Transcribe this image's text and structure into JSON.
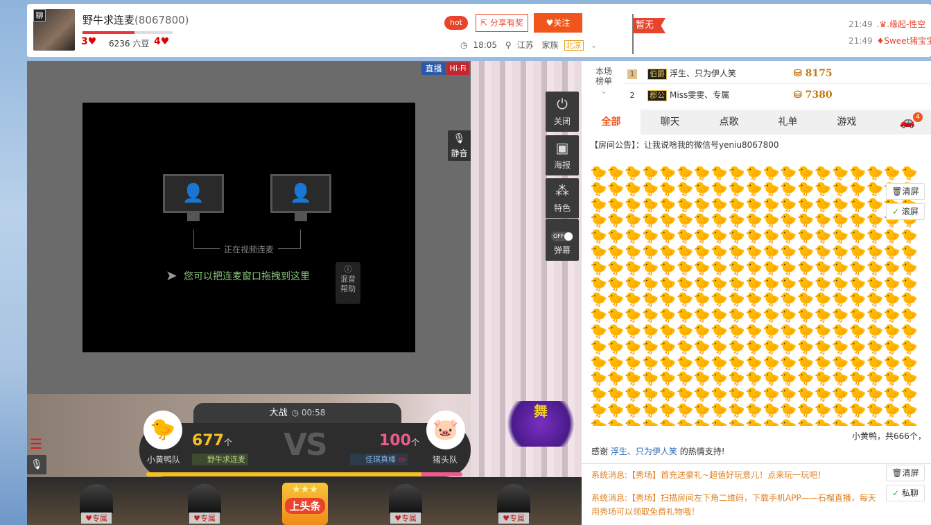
{
  "header": {
    "avatar_badge": "聊",
    "anchor_name": "野牛求连麦",
    "anchor_id": "(8067800)",
    "level_progress": 0.58,
    "level_left": "3",
    "douzi": "6236 六豆",
    "level_right": "4",
    "hot": "hot",
    "share": "分享有奖",
    "follow": "关注",
    "time": "18:05",
    "location": "江苏",
    "family_label": "家族",
    "family_tag": "北凉",
    "flag": "暂无",
    "messages": [
      {
        "time": "21:49",
        "user": ".♛.缘起-性空"
      },
      {
        "time": "21:49",
        "user": "♦Sweet猪宝宝"
      }
    ]
  },
  "video": {
    "badge_live": "直播",
    "badge_hifi": "Hi-Fi",
    "mute": "静音",
    "link_text": "正在视频连麦",
    "drag_text": "您可以把连麦窗口拖拽到这里",
    "mix_help_l1": "混音",
    "mix_help_l2": "帮助"
  },
  "side_tools": {
    "close": "关闭",
    "poster": "海报",
    "feature": "特色",
    "danmu_state": "OFF",
    "danmu": "弹幕"
  },
  "battle": {
    "title": "大战",
    "timer": "00:58",
    "left_team": "小黄鸭队",
    "right_team": "猪头队",
    "left_score": "677",
    "right_score": "100",
    "unit": "个",
    "vs": "VS",
    "left_leader": "野牛求连麦",
    "right_leader": "佳琪真棒",
    "left_share": 0.87,
    "event_logo": "舞"
  },
  "gift_row": {
    "tag": "专属",
    "headline": "上头条"
  },
  "rank": {
    "head_l1": "本场",
    "head_l2": "榜单",
    "rows": [
      {
        "num": "1",
        "tag": "伯爵",
        "name": "浮生、只为伊人笑",
        "coins": "8175"
      },
      {
        "num": "2",
        "tag": "郡公",
        "name": "Miss雯雯、专属",
        "coins": "7380"
      }
    ]
  },
  "tabs": {
    "all": "全部",
    "chat": "聊天",
    "song": "点歌",
    "gift": "礼单",
    "game": "游戏",
    "car_badge": "4"
  },
  "chat": {
    "announce": "【房间公告】：让我说啥我的微信号yeniu8067800",
    "duck_count": "小黄鸭，共666个，",
    "thanks_prefix": "感谢",
    "thanks_user": "浮生、只为伊人笑",
    "thanks_suffix": "的热情支持!",
    "clear": "清屏",
    "scroll": "滚屏",
    "sys1": "系统消息:【秀场】首充送豪礼~超值好玩意儿！点来玩一玩吧！",
    "sys2": "系统消息:【秀场】扫描房间左下角二维码，下载手机APP——石榴直播，每天用秀场可以领取免费礼物哦！",
    "private": "私聊"
  }
}
